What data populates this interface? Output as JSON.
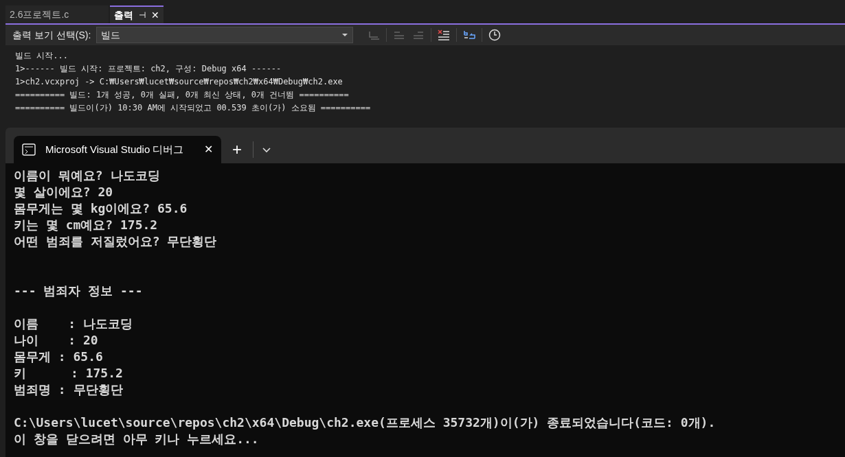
{
  "doc_tabs": [
    {
      "label": "2.6프로젝트.c",
      "selected": false
    },
    {
      "label": "출력",
      "selected": true,
      "pin": "⊣",
      "close": "✕"
    }
  ],
  "output_toolbar": {
    "label": "출력 보기 선택(S):",
    "source": "빌드"
  },
  "output_lines": [
    "빌드 시작...",
    "1>------ 빌드 시작: 프로젝트: ch2, 구성: Debug x64 ------",
    "1>ch2.vcxproj -> C:₩Users₩lucet₩source₩repos₩ch2₩x64₩Debug₩ch2.exe",
    "========== 빌드: 1개 성공, 0개 실패, 0개 최신 상태, 0개 건너뜀 ==========",
    "========== 빌드이(가) 10:30 AM에 시작되었고 00.539 초이(가) 소요됨 =========="
  ],
  "terminal": {
    "tab_title": "Microsoft Visual Studio 디버그",
    "tab_close": "✕",
    "new_tab": "+",
    "groups": [
      [
        "이름이 뭐예요? 나도코딩",
        "몇 살이에요? 20",
        "몸무게는 몇 kg이에요? 65.6",
        "키는 몇 cm예요? 175.2",
        "어떤 범죄를 저질렀어요? 무단횡단"
      ],
      [
        "--- 범죄자 정보 ---"
      ],
      [
        "이름    : 나도코딩",
        "나이    : 20",
        "몸무게 : 65.6",
        "키      : 175.2",
        "범죄명 : 무단횡단"
      ],
      [
        "C:\\Users\\lucet\\source\\repos\\ch2\\x64\\Debug\\ch2.exe(프로세스 35732개)이(가) 종료되었습니다(코드: 0개).",
        "이 창을 닫으려면 아무 키나 누르세요..."
      ]
    ]
  }
}
